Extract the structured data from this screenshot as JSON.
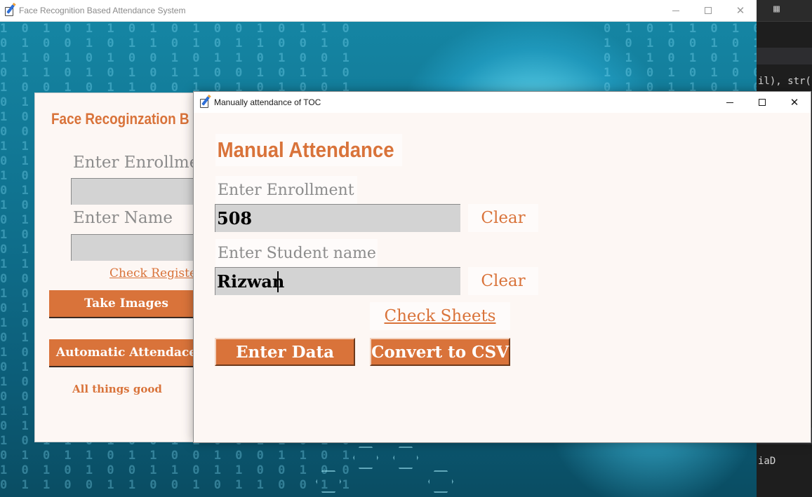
{
  "main_window": {
    "title": "Face Recognition Based Attendance System",
    "heading": "Face Recoginzation B",
    "enroll_label": "Enter Enrollme",
    "enroll_value": "",
    "name_label": "Enter Name",
    "name_value": "",
    "check_link": "Check Register",
    "take_images": "Take Images",
    "automatic_attendance": "Automatic Attendace",
    "status": "All things good"
  },
  "manual_window": {
    "title": "Manually attendance of TOC",
    "heading": "Manual Attendance",
    "enrollment_label": "Enter Enrollment",
    "enrollment_value": "508",
    "clear_enrollment": "Clear",
    "student_label": "Enter Student name",
    "student_value": "Rizwan",
    "clear_student": "Clear",
    "check_sheets": "Check Sheets",
    "enter_data": "Enter Data",
    "convert_csv": "Convert to CSV"
  },
  "background_editor": {
    "code_fragment_top": "il), str(",
    "code_fragment_bottom": "iaD"
  },
  "colors": {
    "accent": "#d9733a",
    "input_bg": "#d3d3d3",
    "window_bg": "#fdf7f4",
    "label": "#8c8c8c"
  },
  "icons": {
    "app": "pen-paper-icon",
    "minimize": "minimize-icon",
    "maximize": "maximize-icon",
    "close": "close-icon",
    "layout": "layout-grid-icon"
  }
}
